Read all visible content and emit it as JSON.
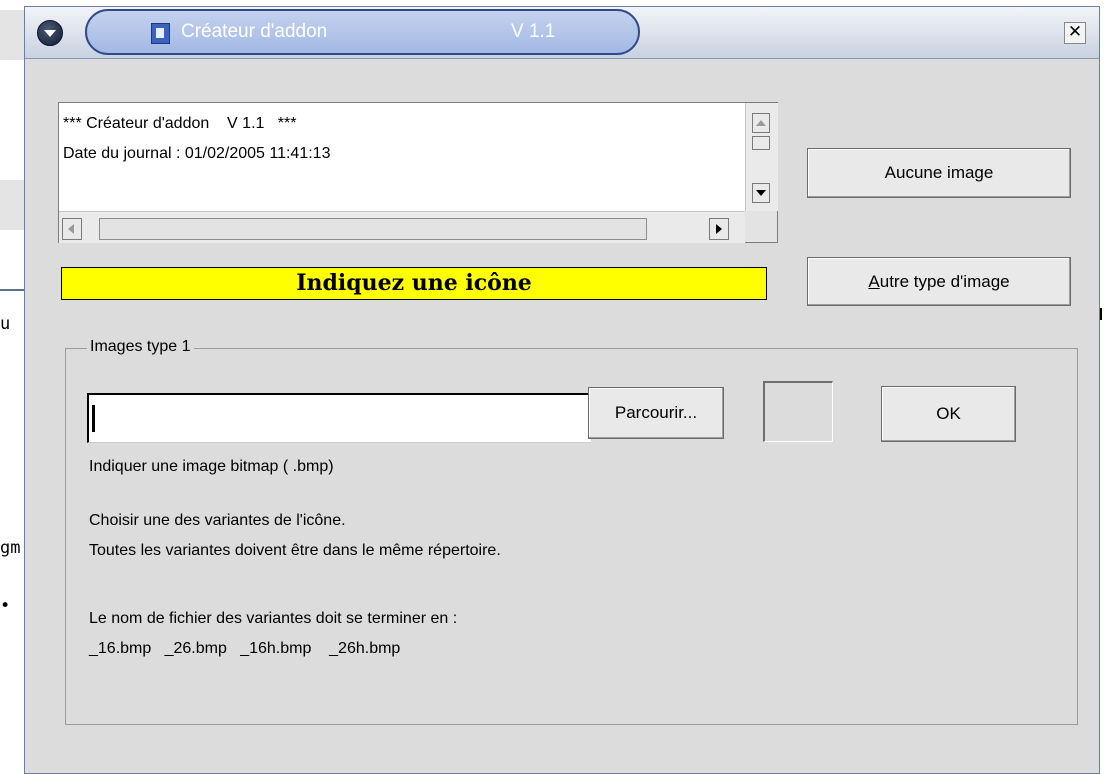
{
  "background": {
    "fragments": [
      "u",
      "gm",
      "•"
    ]
  },
  "window": {
    "title": "Créateur d'addon",
    "version": "V 1.1",
    "close_glyph": "✕"
  },
  "log": {
    "lines": [
      "*** Créateur d'addon    V 1.1   ***",
      "Date du journal : 01/02/2005 11:41:13"
    ]
  },
  "buttons": {
    "no_image": "Aucune image",
    "other_type_prefix": "A",
    "other_type_rest": "utre type d'image",
    "browse": "Parcourir...",
    "ok": "OK"
  },
  "status": {
    "message": "Indiquez une icône",
    "color": "#ffff00"
  },
  "group": {
    "title": "Images type 1",
    "input_value": "",
    "hint": "Indiquer une image bitmap ( .bmp)",
    "instructions": [
      "Choisir une des variantes de l'icône.",
      "Toutes les variantes doivent être dans le même répertoire."
    ],
    "suffix_intro": "Le nom de fichier des variantes doit se terminer en :",
    "suffixes": "_16.bmp   _26.bmp   _16h.bmp    _26h.bmp"
  }
}
